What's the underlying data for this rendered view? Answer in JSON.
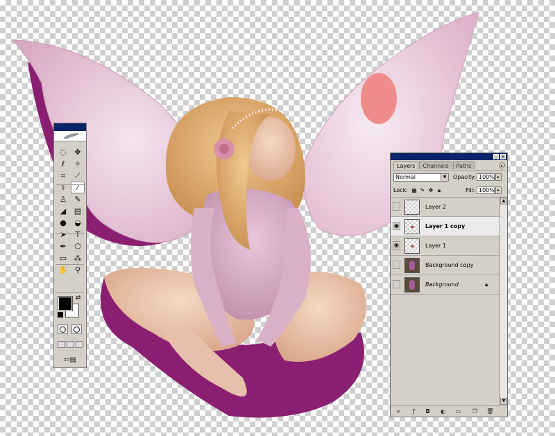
{
  "canvas": {
    "transparency": "checkerboard"
  },
  "tools_palette": {
    "tools": [
      {
        "icon": "marquee-icon",
        "glyph": "◌"
      },
      {
        "icon": "move-icon",
        "glyph": "✥"
      },
      {
        "icon": "lasso-icon",
        "glyph": "ℓ"
      },
      {
        "icon": "magic-wand-icon",
        "glyph": "✧"
      },
      {
        "icon": "crop-icon",
        "glyph": "⌗"
      },
      {
        "icon": "slice-icon",
        "glyph": "⟋"
      },
      {
        "icon": "healing-brush-icon",
        "glyph": "⚕"
      },
      {
        "icon": "brush-icon",
        "glyph": "⁄",
        "active": true
      },
      {
        "icon": "clone-stamp-icon",
        "glyph": "♙"
      },
      {
        "icon": "history-brush-icon",
        "glyph": "✎"
      },
      {
        "icon": "eraser-icon",
        "glyph": "◢"
      },
      {
        "icon": "gradient-icon",
        "glyph": "▤"
      },
      {
        "icon": "blur-icon",
        "glyph": "●"
      },
      {
        "icon": "dodge-icon",
        "glyph": "◒"
      },
      {
        "icon": "path-select-icon",
        "glyph": "➤"
      },
      {
        "icon": "type-tool-icon",
        "glyph": "T"
      },
      {
        "icon": "pen-icon",
        "glyph": "✒"
      },
      {
        "icon": "shape-icon",
        "glyph": "⬠"
      },
      {
        "icon": "notes-icon",
        "glyph": "▭"
      },
      {
        "icon": "eyedropper-icon",
        "glyph": "⁂"
      },
      {
        "icon": "hand-icon",
        "glyph": "✋"
      },
      {
        "icon": "zoom-icon",
        "glyph": "⚲"
      }
    ],
    "foreground_color": "#000000",
    "background_color": "#ffffff"
  },
  "layers_panel": {
    "tabs": [
      "Layers",
      "Channels",
      "Paths"
    ],
    "blend_mode": "Normal",
    "opacity_label": "Opacity:",
    "opacity": "100%",
    "lock_label": "Lock:",
    "fill_label": "Fill:",
    "fill": "100%",
    "layers": [
      {
        "name": "Layer 2",
        "visible": false,
        "selected": false,
        "thumb": "transparent"
      },
      {
        "name": "Layer 1 copy",
        "visible": true,
        "selected": true,
        "thumb": "transparent"
      },
      {
        "name": "Layer 1",
        "visible": true,
        "selected": false,
        "thumb": "transparent"
      },
      {
        "name": "Background copy",
        "visible": false,
        "selected": false,
        "thumb": "photo"
      },
      {
        "name": "Background",
        "visible": false,
        "selected": false,
        "thumb": "photo",
        "locked": true
      }
    ]
  }
}
